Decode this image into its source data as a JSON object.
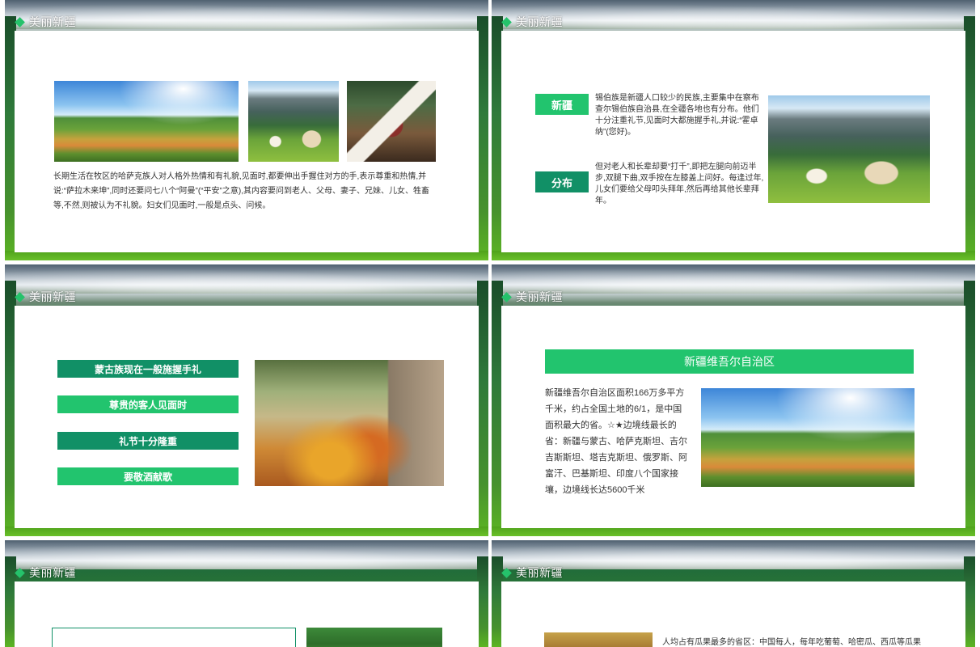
{
  "header_title": "美丽新疆",
  "slide1": {
    "body": "长期生活在牧区的哈萨克族人对人格外热情和有礼貌,见面时,都要伸出手握住对方的手,表示尊重和热情,并说:“萨拉木来坤”,同时还要问七八个“阿曼”(“平安”之意),其内容要问到老人、父母、妻子、兄妹、儿女、牲畜等,不然,则被认为不礼貌。妇女们见面时,一般是点头、问候。"
  },
  "slide2": {
    "tag1": "新疆",
    "text1": "锡伯族是新疆人口较少的民族,主要集中在察布查尔锡伯族自治县,在全疆各地也有分布。他们十分注重礼节,见面时大都施握手礼,并说:“霍卓纳”(您好)。",
    "tag2": "分布",
    "text2": "但对老人和长辈却要“打千”,即把左腿向前迈半步,双腿下曲,双手按在左膝盖上问好。每逢过年,儿女们要给父母叩头拜年,然后再给其他长辈拜年。"
  },
  "slide3": {
    "bars": [
      "蒙古族现在一般施握手礼",
      "尊贵的客人见面时",
      "礼节十分隆重",
      "要敬酒献歌"
    ]
  },
  "slide4": {
    "banner": "新疆维吾尔自治区",
    "body": "新疆维吾尔自治区面积166万多平方千米，约占全国土地的6/1，是中国面积最大的省。☆★边境线最长的省：新疆与蒙古、哈萨克斯坦、吉尔吉斯斯坦、塔吉克斯坦、俄罗斯、阿富汗、巴基斯坦、印度八个国家接壤，边境线长达5600千米"
  },
  "slide6": {
    "body": "人均占有瓜果最多的省区：中国每人，每年吃葡萄、哈密瓜、西瓜等瓜果"
  }
}
